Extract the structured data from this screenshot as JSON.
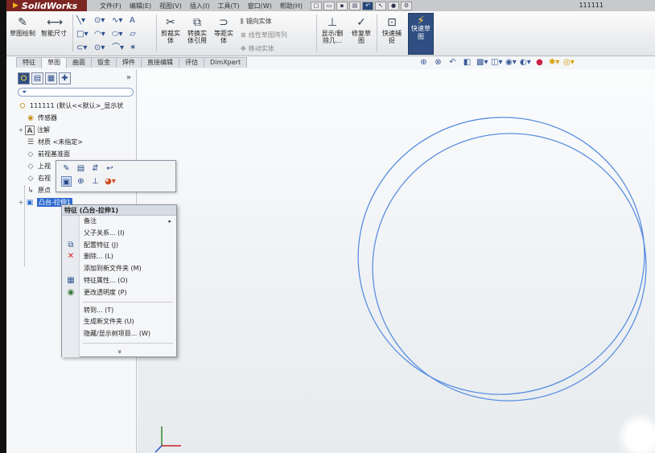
{
  "app": {
    "brand": "SolidWorks",
    "document_title": "111111",
    "menu": [
      "文件(F)",
      "编辑(E)",
      "视图(V)",
      "插入(I)",
      "工具(T)",
      "窗口(W)",
      "帮助(H)"
    ]
  },
  "ribbon": {
    "sketch_button": "草图绘制",
    "smart_dim_button": "智能尺寸",
    "trim_button": "剪裁实体",
    "convert_button": "转换实体引用",
    "offset_button": "等距实体",
    "mirror_label": "镜向实体",
    "linear_pattern_label": "线性草图阵列",
    "move_label": "移动实体",
    "show_relations_button": "显示/删除几...",
    "repair_button": "修复草图",
    "quick_snaps_button": "快速捕捉",
    "rapid_sketch_button": "快速草图"
  },
  "tabs": [
    "特征",
    "草图",
    "曲面",
    "钣金",
    "焊件",
    "直接编辑",
    "评估",
    "DimXpert"
  ],
  "active_tab": "草图",
  "tree": {
    "root": "111111 (默认<<默认>_显示状",
    "items": [
      {
        "label": "传感器",
        "icon": "sensor-icon"
      },
      {
        "label": "注解",
        "icon": "annotation-icon"
      },
      {
        "label": "材质 <未指定>",
        "icon": "material-icon"
      },
      {
        "label": "前视基准面",
        "icon": "plane-icon"
      },
      {
        "label": "上视",
        "icon": "plane-icon"
      },
      {
        "label": "右视",
        "icon": "plane-icon"
      },
      {
        "label": "原点",
        "icon": "origin-icon"
      },
      {
        "label": "凸台-拉伸1",
        "icon": "extrude-icon"
      }
    ]
  },
  "context_menu": {
    "title": "特征 (凸台-拉伸1)",
    "items": [
      {
        "label": "备注",
        "submenu": true
      },
      {
        "label": "父子关系... (I)"
      },
      {
        "label": "配置特征 (J)"
      },
      {
        "label": "删除... (L)"
      },
      {
        "label": "添加到新文件夹 (M)"
      },
      {
        "label": "特征属性... (O)"
      },
      {
        "label": "更改透明度 (P)"
      },
      {
        "label": "转到... (T)"
      },
      {
        "label": "生成新文件夹 (U)"
      },
      {
        "label": "隐藏/显示树项目... (W)"
      }
    ],
    "more": "»"
  },
  "colors": {
    "brand_red": "#7b2622",
    "selection_blue": "#2f6bd0",
    "edge_blue": "#5a8fe0"
  }
}
